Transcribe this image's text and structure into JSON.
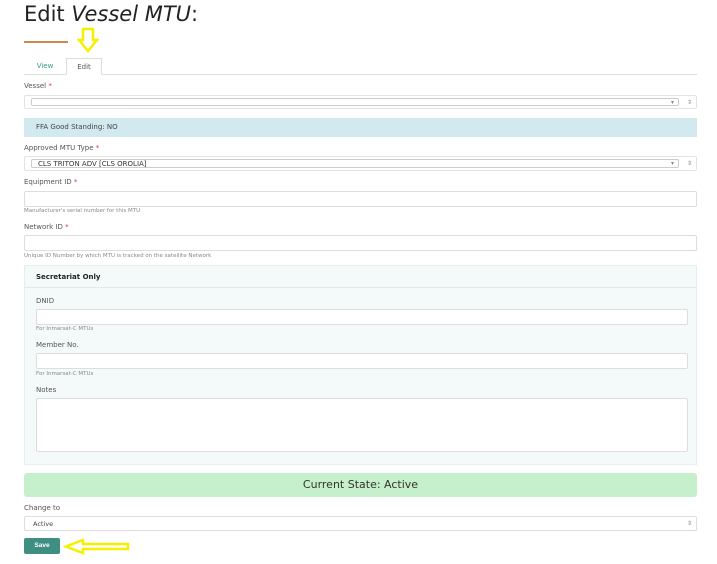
{
  "header": {
    "title_prefix": "Edit ",
    "title_italic": "Vessel MTU",
    "title_suffix": ":"
  },
  "tabs": [
    {
      "label": "View"
    },
    {
      "label": "Edit"
    }
  ],
  "form": {
    "vessel": {
      "label": "Vessel",
      "required": "*",
      "value": ""
    },
    "standing": {
      "text": "FFA Good Standing: NO"
    },
    "mtu_type": {
      "label": "Approved MTU Type",
      "required": "*",
      "value": "CLS TRITON ADV [CLS OROLIA]"
    },
    "equipment_id": {
      "label": "Equipment ID",
      "required": "*",
      "value": "",
      "help": "Manufacturer's serial number for this MTU"
    },
    "network_id": {
      "label": "Network ID",
      "required": "*",
      "value": "",
      "help": "Unique ID Number by which MTU is tracked on the satellite Network"
    },
    "secretariat": {
      "title": "Secretariat Only",
      "dnid": {
        "label": "DNID",
        "value": "",
        "help": "For Inmarsat-C MTUs"
      },
      "member_no": {
        "label": "Member No.",
        "value": "",
        "help": "For Inmarsat-C MTUs"
      },
      "notes": {
        "label": "Notes",
        "value": ""
      }
    },
    "current_state": "Current State: Active",
    "change_to": {
      "label": "Change to",
      "value": "Active"
    },
    "save_label": "Save"
  },
  "colors": {
    "accent": "#3e8f82",
    "info": "#d1e9ef",
    "success": "#c6efcb",
    "annotation": "#ffff00"
  }
}
